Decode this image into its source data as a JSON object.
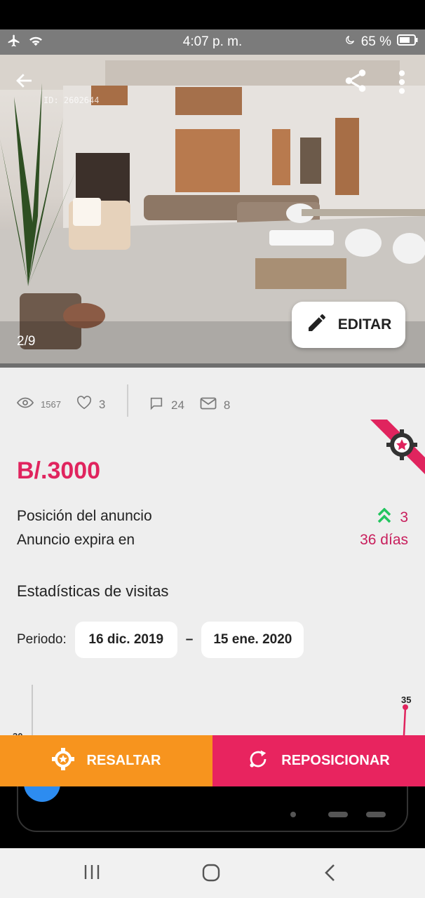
{
  "status_bar": {
    "time": "4:07 p. m.",
    "battery_percent": "65 %",
    "icons": [
      "airplane-icon",
      "wifi-icon",
      "moon-icon",
      "battery-icon"
    ]
  },
  "listing": {
    "id_watermark": "ID: 2602644",
    "photo_counter": "2/9",
    "edit_label": "EDITAR"
  },
  "stats": {
    "views": "1567",
    "likes": "3",
    "comments": "24",
    "messages": "8"
  },
  "price": "B/.3000",
  "position": {
    "label": "Posición del anuncio",
    "value": "3"
  },
  "expiry": {
    "label": "Anuncio expira en",
    "value": "36 días"
  },
  "visits": {
    "title": "Estadísticas de visitas",
    "period_label": "Periodo:",
    "start_date": "16 dic. 2019",
    "separator": "–",
    "end_date": "15 ene. 2020"
  },
  "chart_data": {
    "type": "line",
    "title": "",
    "data_labels": [
      "35",
      "30"
    ],
    "values_visible": [
      35
    ],
    "note_color": "#e0245e"
  },
  "actions": {
    "highlight_label": "RESALTAR",
    "reposition_label": "REPOSICIONAR"
  },
  "colors": {
    "accent": "#e0245e",
    "orange": "#f7941e",
    "green_up": "#22c55e"
  }
}
